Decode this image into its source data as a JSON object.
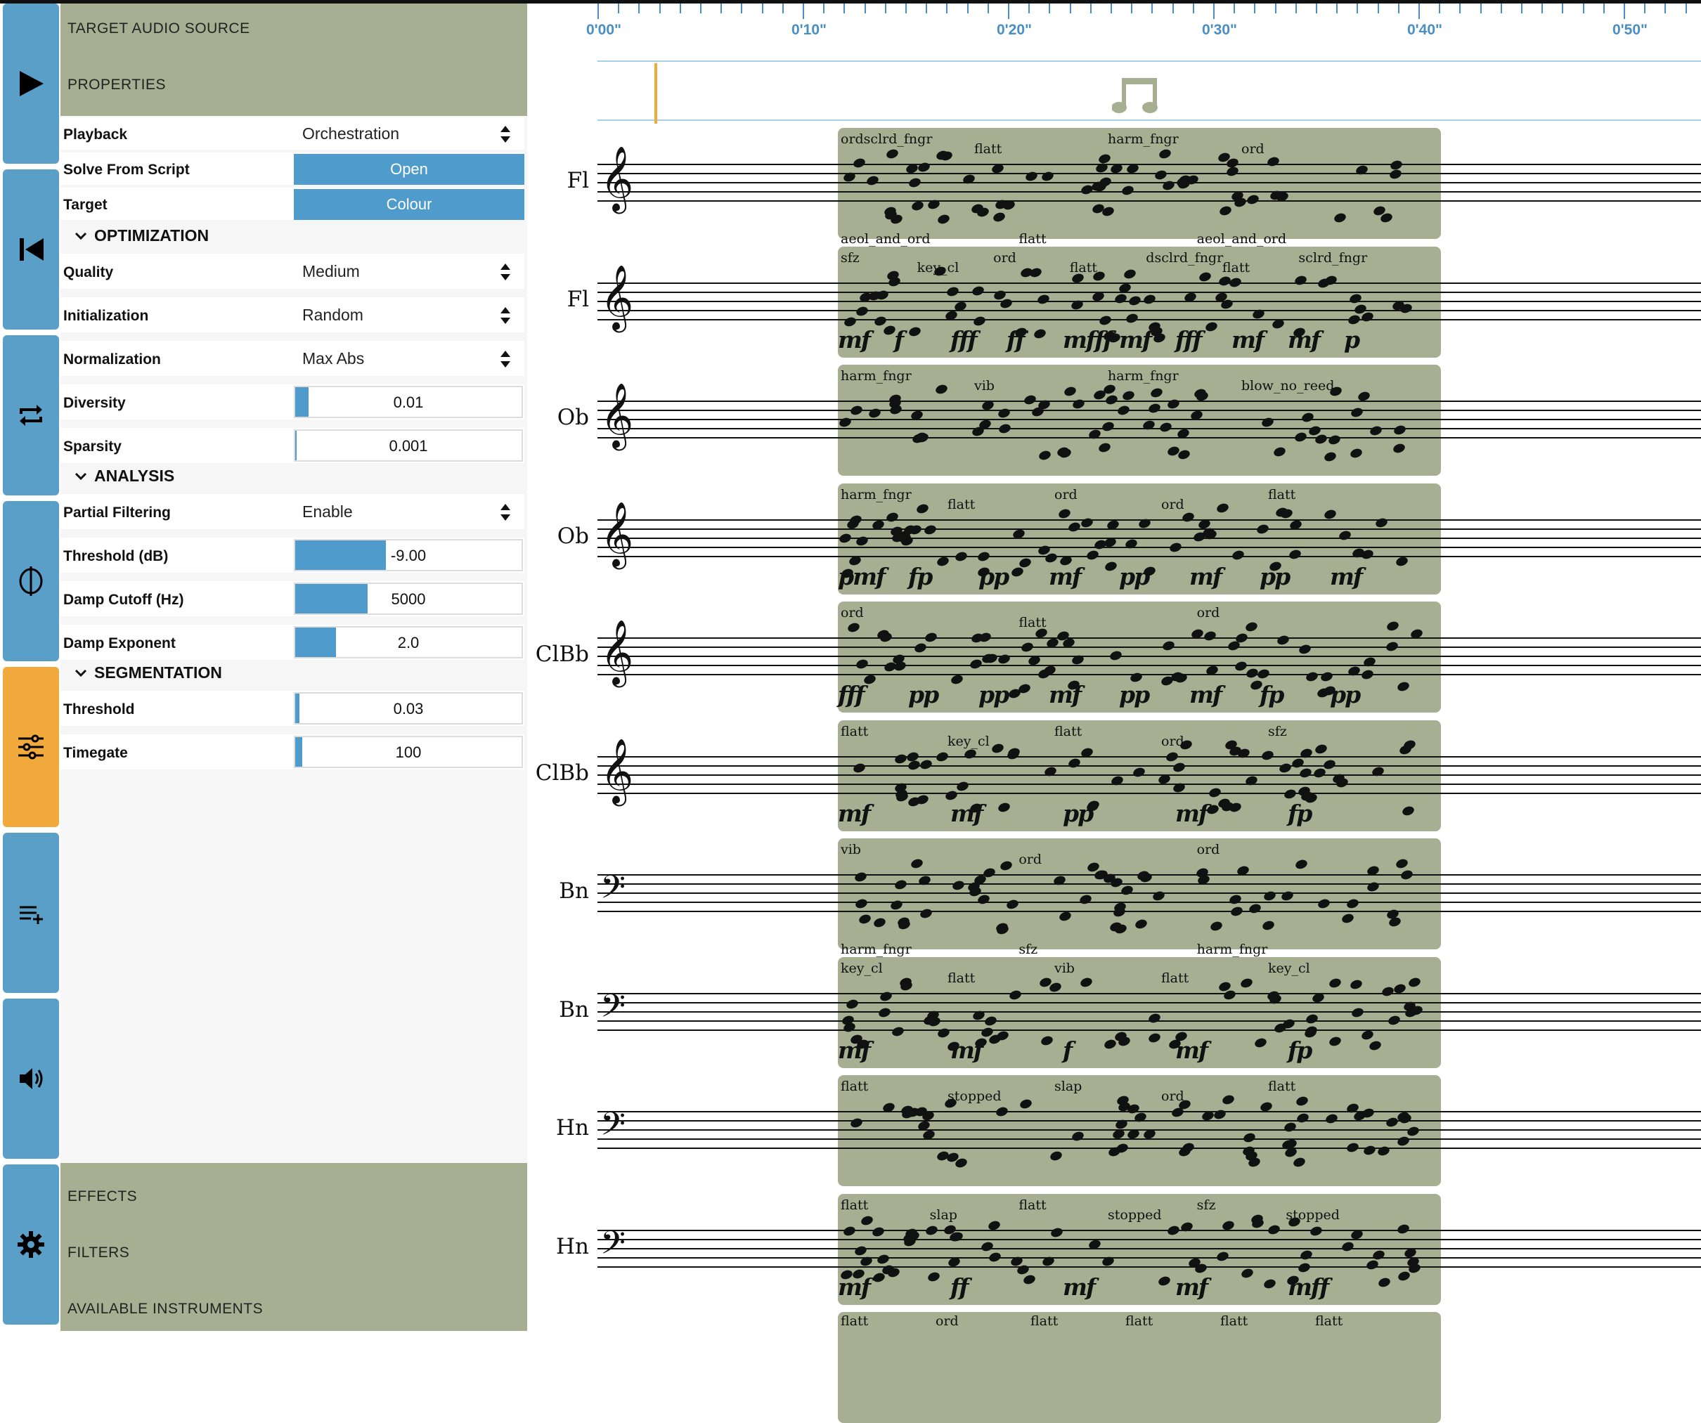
{
  "colors": {
    "accent": "#4f9bcc",
    "active": "#f2a93b",
    "olive": "#a7ae92"
  },
  "rail": [
    {
      "icon": "play-icon"
    },
    {
      "icon": "skip-back-icon"
    },
    {
      "icon": "repeat-icon"
    },
    {
      "icon": "phase-icon"
    },
    {
      "icon": "sliders-icon",
      "active": true
    },
    {
      "icon": "playlist-add-icon"
    },
    {
      "icon": "speaker-icon"
    },
    {
      "icon": "gear-icon"
    }
  ],
  "panel": {
    "headers": {
      "target_audio_source": "TARGET AUDIO SOURCE",
      "properties": "PROPERTIES"
    },
    "playback": {
      "label": "Playback",
      "value": "Orchestration"
    },
    "solve_from_script": {
      "label": "Solve From Script",
      "button": "Open"
    },
    "target": {
      "label": "Target",
      "button": "Colour"
    },
    "optimization": {
      "title": "OPTIMIZATION",
      "quality": {
        "label": "Quality",
        "value": "Medium"
      },
      "initialization": {
        "label": "Initialization",
        "value": "Random"
      },
      "normalization": {
        "label": "Normalization",
        "value": "Max Abs"
      },
      "diversity": {
        "label": "Diversity",
        "value": "0.01",
        "level": 0.06
      },
      "sparsity": {
        "label": "Sparsity",
        "value": "0.001",
        "level": 0.005
      }
    },
    "analysis": {
      "title": "ANALYSIS",
      "partial_filtering": {
        "label": "Partial Filtering",
        "value": "Enable"
      },
      "threshold_db": {
        "label": "Threshold (dB)",
        "value": "-9.00",
        "level": 0.4
      },
      "damp_cutoff": {
        "label": "Damp Cutoff (Hz)",
        "value": "5000",
        "level": 0.32
      },
      "damp_exponent": {
        "label": "Damp Exponent",
        "value": "2.0",
        "level": 0.18
      }
    },
    "segmentation": {
      "title": "SEGMENTATION",
      "threshold": {
        "label": "Threshold",
        "value": "0.03",
        "level": 0.02
      },
      "timegate": {
        "label": "Timegate",
        "value": "100",
        "level": 0.03
      }
    },
    "footer": {
      "effects": "EFFECTS",
      "filters": "FILTERS",
      "available_instruments": "AVAILABLE INSTRUMENTS"
    }
  },
  "timeline": {
    "labels": [
      "0'00\"",
      "0'10\"",
      "0'20\"",
      "0'30\"",
      "0'40\"",
      "0'50\""
    ],
    "playhead_seconds": 0
  },
  "score": {
    "instruments": [
      "Fl",
      "Fl",
      "Ob",
      "Ob",
      "ClBb",
      "ClBb",
      "Bn",
      "Bn",
      "Hn",
      "Hn"
    ],
    "clefs": [
      "treble",
      "treble",
      "treble",
      "treble",
      "treble",
      "treble",
      "bass",
      "bass",
      "bass",
      "bass"
    ],
    "annotations": {
      "fl1_top": [
        "ordsclrd_fngr",
        "flatt",
        "harm_fngr",
        "ord"
      ],
      "fl1_bottom": [
        "aeol_and_ord",
        "flatt",
        "aeol_and_ord"
      ],
      "fl2_top": [
        "sfz",
        "key_cl",
        "ord",
        "flatt",
        "dsclrd_fngr",
        "flatt",
        "sclrd_fngr"
      ],
      "fl2_dyn": [
        "mf",
        "f",
        "fff",
        "ff",
        "mfff",
        "mf",
        "fff",
        "mf",
        "mf",
        "p"
      ],
      "ob1_top": [
        "harm_fngr",
        "vib",
        "harm_fngr",
        "blow_no_reed"
      ],
      "ob2_top": [
        "harm_fngr",
        "flatt",
        "ord",
        "ord",
        "flatt"
      ],
      "ob2_dyn": [
        "pmf",
        "fp",
        "pp",
        "mf",
        "pp",
        "mf",
        "pp",
        "mf"
      ],
      "cl1_top": [
        "ord",
        "flatt",
        "ord"
      ],
      "cl1_dyn": [
        "fff",
        "pp",
        "pp",
        "mf",
        "pp",
        "mf",
        "fp",
        "pp"
      ],
      "cl2_top": [
        "flatt",
        "key_cl",
        "flatt",
        "ord",
        "sfz"
      ],
      "cl2_dyn": [
        "mf",
        "mf",
        "pp",
        "mf",
        "fp"
      ],
      "bn1_top": [
        "vib",
        "ord",
        "ord"
      ],
      "bn1_bottom": [
        "harm_fngr",
        "sfz",
        "harm_fngr"
      ],
      "bn2_top": [
        "key_cl",
        "flatt",
        "vib",
        "flatt",
        "key_cl"
      ],
      "bn2_dyn": [
        "mf",
        "mf",
        "f",
        "mf",
        "fp"
      ],
      "hn1_top": [
        "flatt",
        "stopped",
        "slap",
        "ord",
        "flatt"
      ],
      "hn2_top": [
        "flatt",
        "slap",
        "flatt",
        "stopped",
        "sfz",
        "stopped"
      ],
      "hn2_dyn": [
        "mf",
        "ff",
        "mf",
        "mf",
        "mff"
      ],
      "bottom_row": [
        "flatt",
        "ord",
        "flatt",
        "flatt",
        "flatt",
        "flatt"
      ]
    }
  }
}
